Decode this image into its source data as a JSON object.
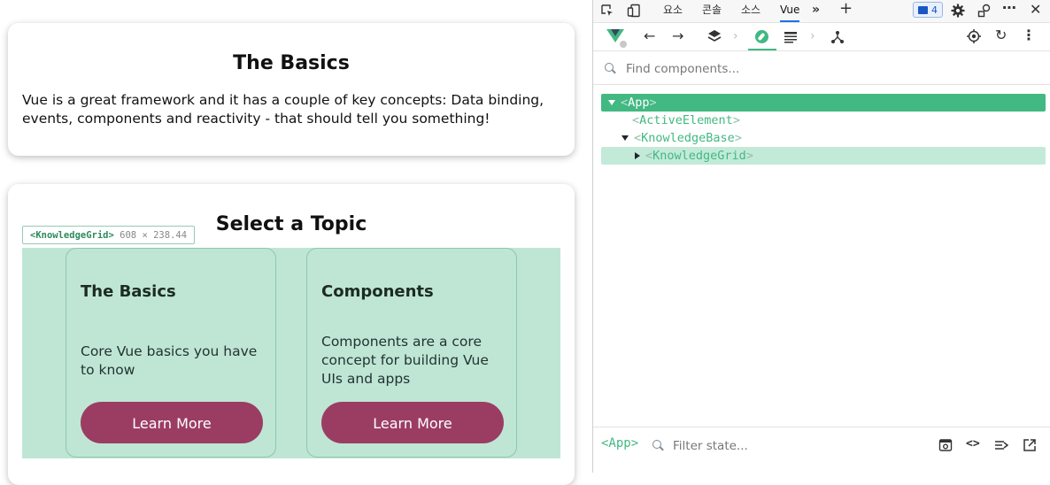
{
  "app": {
    "intro_card": {
      "title": "The Basics",
      "body": "Vue is a great framework and it has a couple of key concepts: Data binding, events, components and reactivity - that should tell you something!"
    },
    "topics_card": {
      "title": "Select a Topic",
      "inspect_label": {
        "tag": "<KnowledgeGrid>",
        "size": "608 × 238.44"
      },
      "topics": [
        {
          "title": "The Basics",
          "description": "Core Vue basics you have to know",
          "button": "Learn More"
        },
        {
          "title": "Components",
          "description": "Components are a core concept for building Vue UIs and apps",
          "button": "Learn More"
        }
      ]
    }
  },
  "devtools": {
    "tabs": [
      {
        "label": "요소"
      },
      {
        "label": "콘솔"
      },
      {
        "label": "소스"
      },
      {
        "label": "Vue",
        "active": true
      }
    ],
    "message_count": "4",
    "search_placeholder": "Find components...",
    "tree": [
      {
        "open": "<",
        "name": "App",
        "close": ">"
      },
      {
        "open": "<",
        "name": "ActiveElement",
        "close": ">"
      },
      {
        "open": "<",
        "name": "KnowledgeBase",
        "close": ">"
      },
      {
        "open": "<",
        "name": "KnowledgeGrid",
        "close": ">"
      }
    ],
    "bottom": {
      "selected_component": "<App>",
      "filter_placeholder": "Filter state..."
    },
    "icons": [
      "inspect-element-icon",
      "device-toolbar-icon",
      "more-tabs-icon",
      "add-tab-icon",
      "issues-icon",
      "settings-icon",
      "customize-icon",
      "more-options-icon",
      "close-icon"
    ]
  },
  "colors": {
    "vue_green": "#42b883",
    "button": "#9b3d63",
    "highlight": "#bfe6d4"
  }
}
